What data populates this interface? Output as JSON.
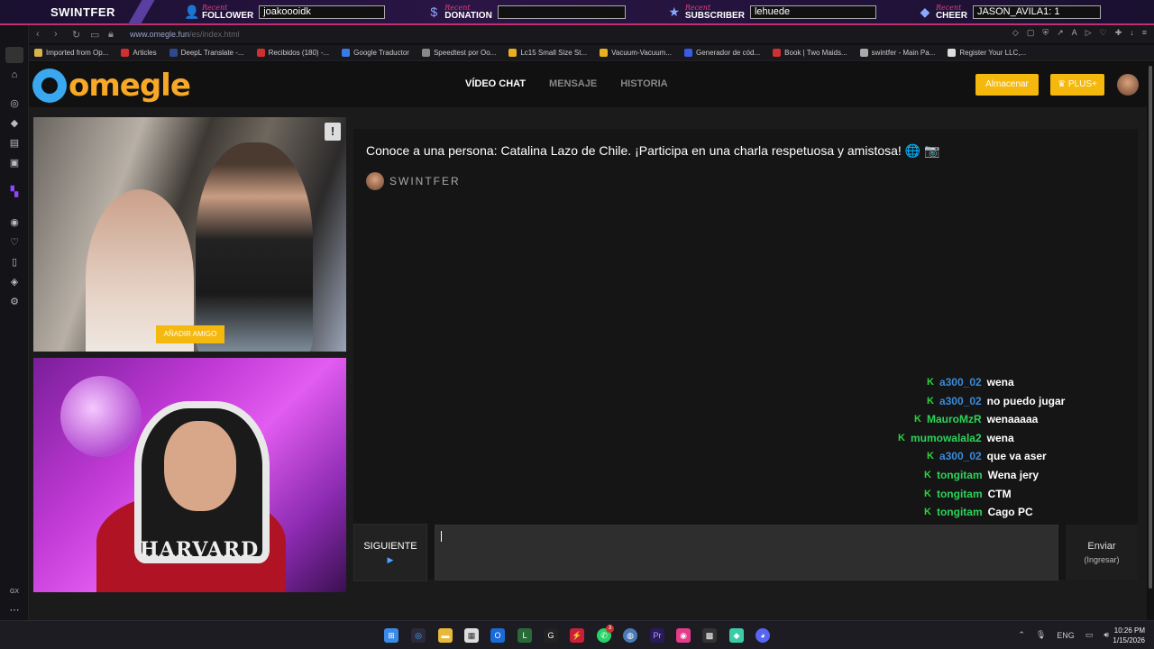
{
  "overlay": {
    "brand": "SWINTFER",
    "recent": "Recent",
    "follower": {
      "label": "FOLLOWER",
      "value": "joakoooidk"
    },
    "donation": {
      "label": "DONATION",
      "value": ""
    },
    "subscriber": {
      "label": "SUBSCRIBER",
      "value": "lehuede"
    },
    "cheer": {
      "label": "CHEER",
      "value": "JASON_AVILA1: 1"
    }
  },
  "browser": {
    "url_host": "www.omegle.fun",
    "url_path": "/es/index.html",
    "bookmarks": [
      {
        "label": "Imported from Op...",
        "color": "#d8b24a"
      },
      {
        "label": "Articles",
        "color": "#d03030"
      },
      {
        "label": "DeepL Translate -...",
        "color": "#2c4a8c"
      },
      {
        "label": "Recibidos (180) -...",
        "color": "#d03030"
      },
      {
        "label": "Google Traductor",
        "color": "#3a7ae8"
      },
      {
        "label": "Speedtest por Oo...",
        "color": "#888888"
      },
      {
        "label": "Lc15 Small Size St...",
        "color": "#e8b020"
      },
      {
        "label": "Vacuum-Vacuum...",
        "color": "#e8b020"
      },
      {
        "label": "Generador de cód...",
        "color": "#3a5ae8"
      },
      {
        "label": "Book | Two Maids...",
        "color": "#d03030"
      },
      {
        "label": "swintfer - Main Pa...",
        "color": "#aaaaaa"
      },
      {
        "label": "Register Your LLC,...",
        "color": "#dddddd"
      }
    ]
  },
  "header": {
    "logo": "omegle",
    "tabs": [
      {
        "label": "VÍDEO CHAT",
        "active": true
      },
      {
        "label": "MENSAJE",
        "active": false
      },
      {
        "label": "HISTORIA",
        "active": false
      }
    ],
    "store_label": "Almacenar",
    "plus_label": "♛ PLUS+"
  },
  "video": {
    "report": "!",
    "add_friend": "AÑADIR AMIGO",
    "hoodie_text": "HARVARD"
  },
  "chat": {
    "message": "Conoce a una persona: Catalina Lazo de Chile. ¡Participa en una charla respetuosa y amistosa! 🌐 📷",
    "user": "SWINTFER",
    "next_label": "SIGUIENTE",
    "next_icon": "▶",
    "send_label": "Enviar",
    "send_hint": "(Ingresar)"
  },
  "twitch_chat": [
    {
      "user": "a300_02",
      "text": "wena",
      "color": "#3a8ad8"
    },
    {
      "user": "a300_02",
      "text": "no puedo jugar",
      "color": "#3a8ad8"
    },
    {
      "user": "MauroMzR",
      "text": "wenaaaaa",
      "color": "#2cd35a"
    },
    {
      "user": "mumowalala2",
      "text": "wena",
      "color": "#2cd35a"
    },
    {
      "user": "a300_02",
      "text": "que va aser",
      "color": "#3a8ad8"
    },
    {
      "user": "tongitam",
      "text": "Wena jery",
      "color": "#2cd35a"
    },
    {
      "user": "tongitam",
      "text": "CTM",
      "color": "#2cd35a"
    },
    {
      "user": "tongitam",
      "text": "Cago PC",
      "color": "#2cd35a"
    }
  ],
  "taskbar": {
    "lang": "ENG",
    "time": "10:26 PM",
    "date": "1/15/2026",
    "whatsapp_badge": "3"
  }
}
